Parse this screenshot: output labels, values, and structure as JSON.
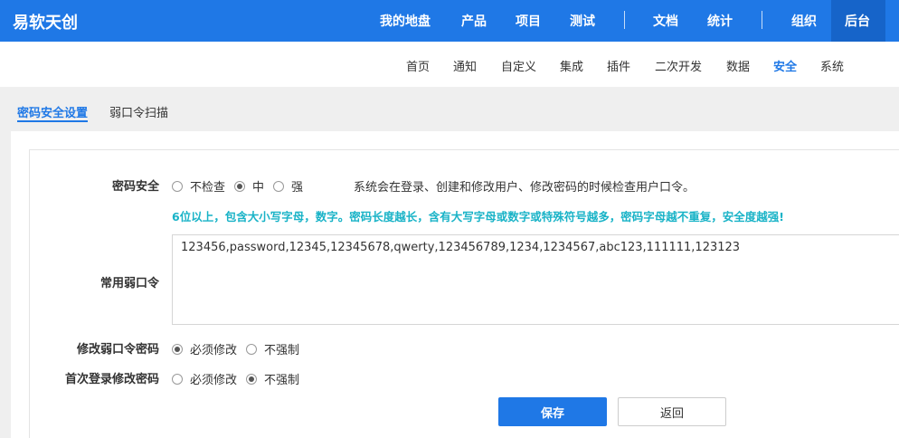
{
  "app": {
    "title": "易软天创"
  },
  "topnav": {
    "items": [
      "我的地盘",
      "产品",
      "项目",
      "测试",
      "文档",
      "统计",
      "组织",
      "后台"
    ],
    "active": "后台"
  },
  "subnav": {
    "items": [
      "首页",
      "通知",
      "自定义",
      "集成",
      "插件",
      "二次开发",
      "数据",
      "安全",
      "系统"
    ],
    "active": "安全"
  },
  "tabs": {
    "items": [
      "密码安全设置",
      "弱口令扫描"
    ],
    "active": "密码安全设置"
  },
  "form": {
    "password_security": {
      "label": "密码安全",
      "options": [
        "不检查",
        "中",
        "强"
      ],
      "selected": "中",
      "hint": "系统会在登录、创建和修改用户、修改密码的时候检查用户口令。",
      "tip": "6位以上，包含大小写字母，数字。密码长度越长，含有大写字母或数字或特殊符号越多，密码字母越不重复，安全度越强!"
    },
    "weak_passwords": {
      "label": "常用弱口令",
      "value": "123456,password,12345,12345678,qwerty,123456789,1234,1234567,abc123,111111,123123"
    },
    "change_weak_password": {
      "label": "修改弱口令密码",
      "options": [
        "必须修改",
        "不强制"
      ],
      "selected": "必须修改"
    },
    "first_login_change": {
      "label": "首次登录修改密码",
      "options": [
        "必须修改",
        "不强制"
      ],
      "selected": "不强制"
    },
    "buttons": {
      "save": "保存",
      "back": "返回"
    }
  },
  "colors": {
    "primary": "#1f78e6",
    "tip": "#19b3c7",
    "active_tab_bg": "#1664c9"
  }
}
